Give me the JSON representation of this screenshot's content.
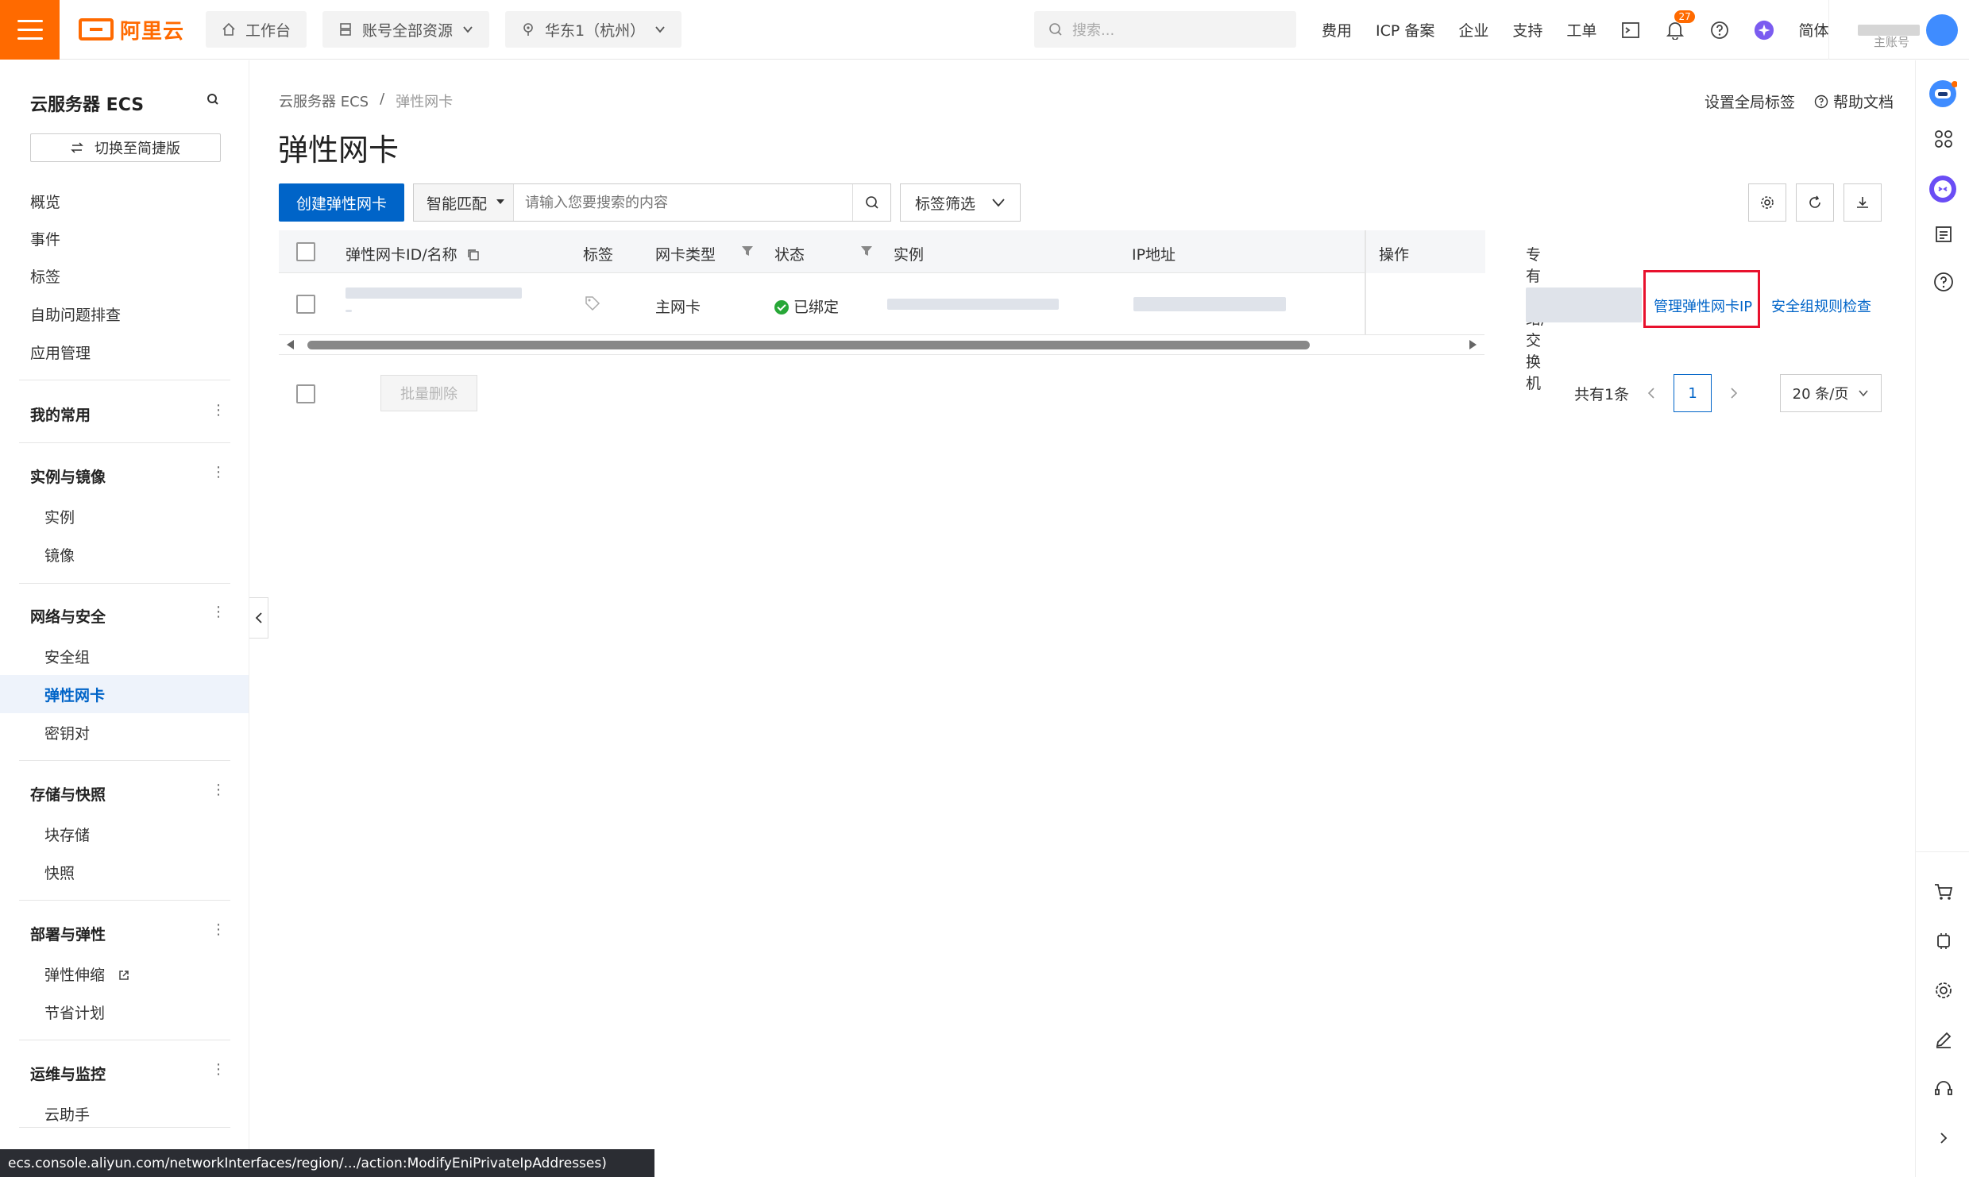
{
  "topbar": {
    "logo_text": "阿里云",
    "workbench": "工作台",
    "resources": "账号全部资源",
    "region": "华东1（杭州）",
    "search_placeholder": "搜索...",
    "links": [
      "费用",
      "ICP 备案",
      "企业",
      "支持",
      "工单"
    ],
    "notification_count": "27",
    "lang": "简体",
    "account_sub": "主账号",
    "accent_color": "#ff6a00"
  },
  "sidebar": {
    "title": "云服务器 ECS",
    "switch_label": "切换至简捷版",
    "top_items": [
      "概览",
      "事件",
      "标签",
      "自助问题排查",
      "应用管理"
    ],
    "groups": [
      {
        "label": "我的常用",
        "items": []
      },
      {
        "label": "实例与镜像",
        "items": [
          "实例",
          "镜像"
        ]
      },
      {
        "label": "网络与安全",
        "items": [
          "安全组",
          "弹性网卡",
          "密钥对"
        ]
      },
      {
        "label": "存储与快照",
        "items": [
          "块存储",
          "快照"
        ]
      },
      {
        "label": "部署与弹性",
        "items": [
          "弹性伸缩",
          "节省计划"
        ]
      },
      {
        "label": "运维与监控",
        "items": [
          "云助手"
        ]
      }
    ],
    "active_item": "弹性网卡"
  },
  "main": {
    "breadcrumb": [
      "云服务器 ECS",
      "弹性网卡"
    ],
    "breadcrumb_sep": "/",
    "title": "弹性网卡",
    "right_links": {
      "global_tags": "设置全局标签",
      "help": "帮助文档"
    },
    "create_button": "创建弹性网卡",
    "search_mode": "智能匹配",
    "search_placeholder": "请输入您要搜索的内容",
    "tag_filter": "标签筛选",
    "table": {
      "columns": [
        "弹性网卡ID/名称",
        "标签",
        "网卡类型",
        "状态",
        "实例",
        "IP地址",
        "专有网络/交换机",
        "操作"
      ],
      "rows": [
        {
          "nic_type": "主网卡",
          "status": "已绑定",
          "actions": [
            "管理弹性网卡IP",
            "安全组规则检查"
          ]
        }
      ]
    },
    "bulk_delete": "批量删除",
    "pager": {
      "total": "共有1条",
      "current_page": "1",
      "page_size": "20 条/页"
    }
  },
  "statusbar": {
    "url": "ecs.console.aliyun.com/networkInterfaces/region/.../action:ModifyEniPrivateIpAddresses)"
  }
}
